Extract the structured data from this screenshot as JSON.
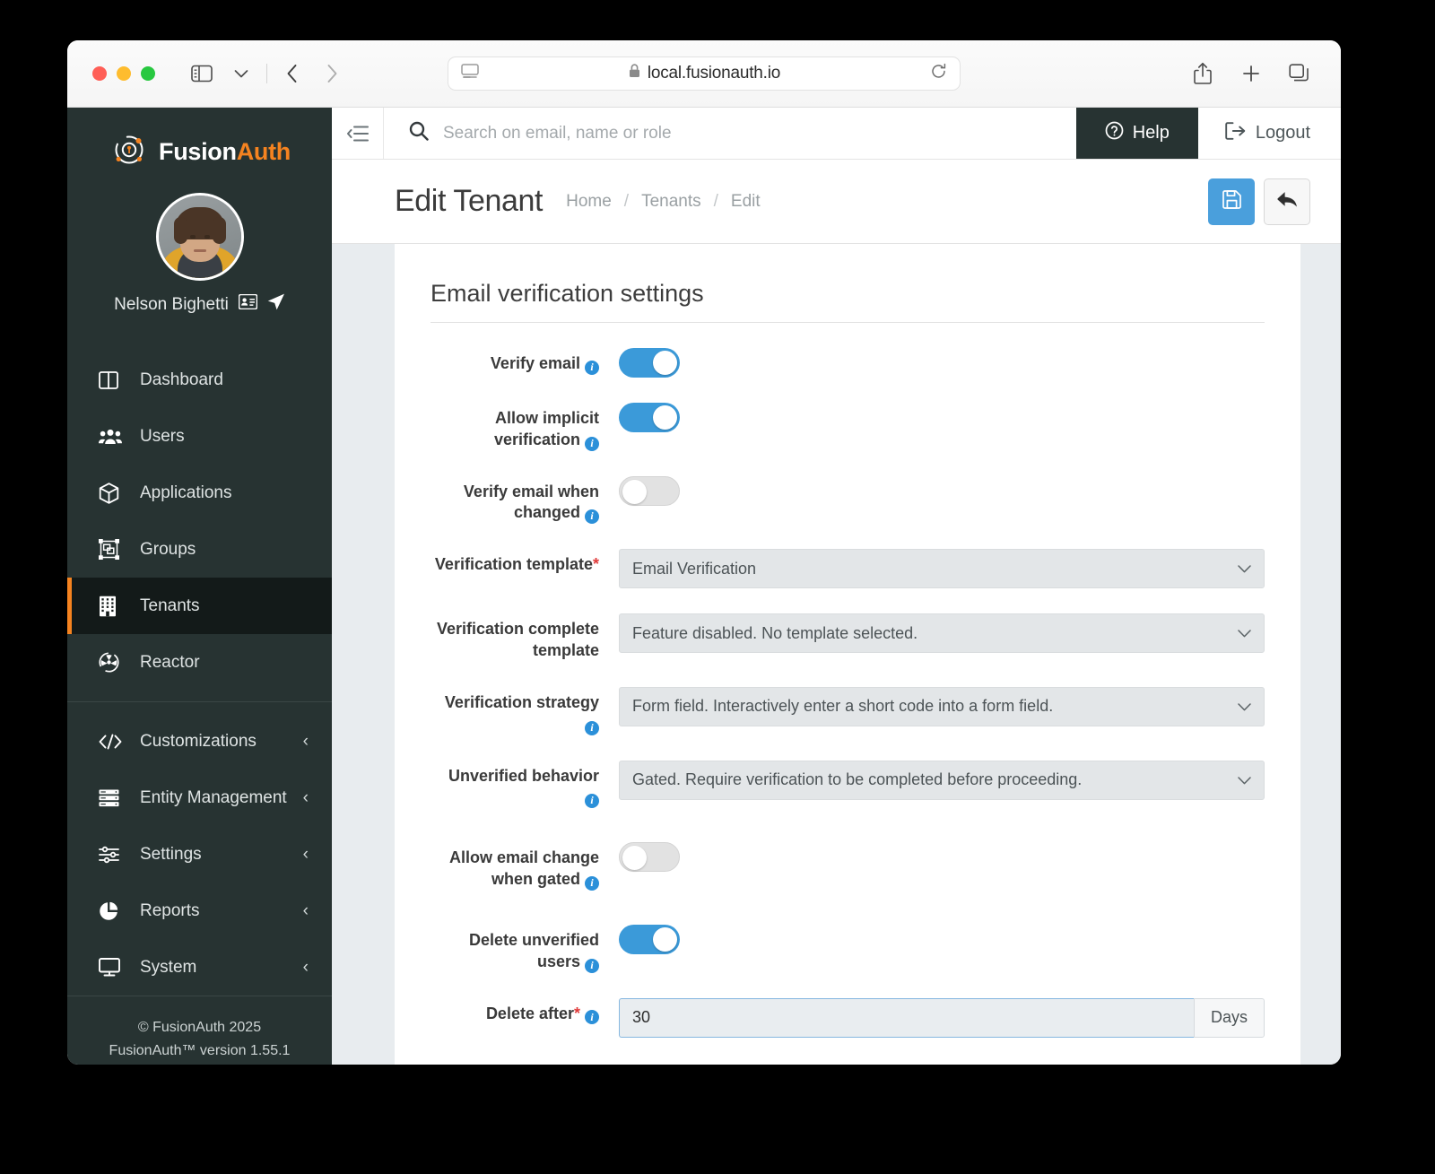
{
  "browser": {
    "url": "local.fusionauth.io",
    "lock_icon": "lock-icon",
    "traffic_lights": [
      "close-red",
      "minimize-yellow",
      "maximize-green"
    ],
    "toolbar_icons": [
      "sidebar-icon",
      "chevron-down-icon",
      "back-arrow-icon",
      "forward-arrow-icon"
    ],
    "right_icons": [
      "share-icon",
      "new-tab-icon",
      "tab-overview-icon"
    ],
    "reload_icon": "reload-icon",
    "reader_icon": "reader-view-icon"
  },
  "sidebar": {
    "brand": {
      "first": "Fusion",
      "second": "Auth",
      "logo_icon": "fusionauth-logo-icon"
    },
    "user": {
      "name": "Nelson Bighetti",
      "avatar_icon": "user-avatar",
      "id_card_icon": "id-card-icon",
      "impersonate_icon": "location-arrow-icon"
    },
    "items": [
      {
        "label": "Dashboard",
        "icon": "dashboard-icon",
        "active": false,
        "expandable": false
      },
      {
        "label": "Users",
        "icon": "users-icon",
        "active": false,
        "expandable": false
      },
      {
        "label": "Applications",
        "icon": "applications-cube-icon",
        "active": false,
        "expandable": false
      },
      {
        "label": "Groups",
        "icon": "groups-icon",
        "active": false,
        "expandable": false
      },
      {
        "label": "Tenants",
        "icon": "tenants-building-icon",
        "active": true,
        "expandable": false
      },
      {
        "label": "Reactor",
        "icon": "reactor-icon",
        "active": false,
        "expandable": false
      },
      {
        "label": "Customizations",
        "icon": "code-icon",
        "active": false,
        "expandable": true
      },
      {
        "label": "Entity Management",
        "icon": "server-stack-icon",
        "active": false,
        "expandable": true
      },
      {
        "label": "Settings",
        "icon": "sliders-icon",
        "active": false,
        "expandable": true
      },
      {
        "label": "Reports",
        "icon": "pie-chart-icon",
        "active": false,
        "expandable": true
      },
      {
        "label": "System",
        "icon": "monitor-icon",
        "active": false,
        "expandable": true
      }
    ],
    "chevron_glyph": "‹",
    "footer": {
      "copyright": "© FusionAuth 2025",
      "version": "FusionAuth™ version 1.55.1"
    }
  },
  "topbar": {
    "collapse_icon": "collapse-sidebar-icon",
    "search_icon": "search-icon",
    "search_placeholder": "Search on email, name or role",
    "search_value": "",
    "help_label": "Help",
    "help_icon": "question-circle-icon",
    "logout_label": "Logout",
    "logout_icon": "sign-out-icon"
  },
  "pagehead": {
    "title": "Edit Tenant",
    "breadcrumb": [
      "Home",
      "Tenants",
      "Edit"
    ],
    "breadcrumb_separator": "/",
    "save_icon": "floppy-disk-save-icon",
    "cancel_icon": "back-arrow-icon"
  },
  "form": {
    "section_title": "Email verification settings",
    "rows": [
      {
        "label": "Verify email",
        "type": "toggle",
        "state": "on",
        "info": true,
        "required": false
      },
      {
        "label": "Allow implicit verification",
        "type": "toggle",
        "state": "on",
        "info": true,
        "required": false
      },
      {
        "label": "Verify email when changed",
        "type": "toggle",
        "state": "off",
        "info": true,
        "required": false
      },
      {
        "label": "Verification template",
        "type": "select",
        "value": "Email Verification",
        "info": false,
        "required": true
      },
      {
        "label": "Verification complete template",
        "type": "select",
        "value": "Feature disabled. No template selected.",
        "info": false,
        "required": false
      },
      {
        "label": "Verification strategy",
        "type": "select",
        "value": "Form field. Interactively enter a short code into a form field.",
        "info": true,
        "required": false
      },
      {
        "label": "Unverified behavior",
        "type": "select",
        "value": "Gated. Require verification to be completed before proceeding.",
        "info": true,
        "required": false
      },
      {
        "label": "Allow email change when gated",
        "type": "toggle",
        "state": "off",
        "info": true,
        "required": false
      },
      {
        "label": "Delete unverified users",
        "type": "toggle",
        "state": "on",
        "info": true,
        "required": false
      },
      {
        "label": "Delete after",
        "type": "input",
        "value": "30",
        "addon": "Days",
        "info": true,
        "required": true,
        "focused": true
      }
    ],
    "select_caret": "⌄"
  },
  "colors": {
    "sidebar_bg": "#273332",
    "sidebar_active_bg": "#131a19",
    "accent_orange": "#f58320",
    "toggle_on": "#3b9ad9",
    "save_blue": "#4a9fdc",
    "info_blue": "#2b90d9",
    "required_red": "#e03a3a",
    "page_bg": "#e8ecef"
  }
}
